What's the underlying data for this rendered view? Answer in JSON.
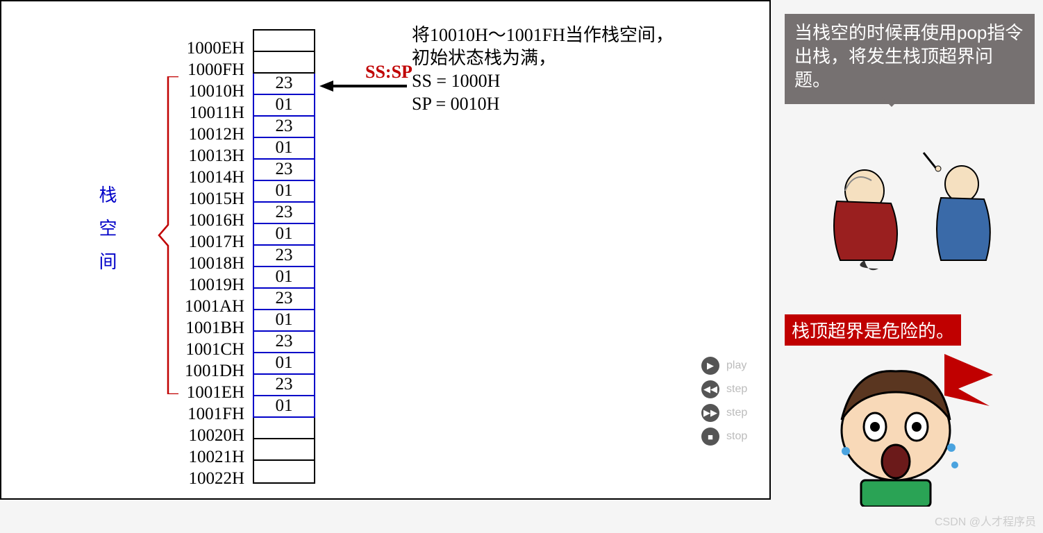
{
  "stack_label": "栈空间",
  "ss_sp_label": "SS:SP",
  "description": {
    "line1": "将10010H～1001FH当作栈空间，",
    "line2": "初始状态栈为满，",
    "line3": "SS = 1000H",
    "line4": "SP = 0010H"
  },
  "addresses": [
    "1000EH",
    "1000FH",
    "10010H",
    "10011H",
    "10012H",
    "10013H",
    "10014H",
    "10015H",
    "10016H",
    "10017H",
    "10018H",
    "10019H",
    "1001AH",
    "1001BH",
    "1001CH",
    "1001DH",
    "1001EH",
    "1001FH",
    "10020H",
    "10021H",
    "10022H"
  ],
  "values": [
    "",
    "",
    "23",
    "01",
    "23",
    "01",
    "23",
    "01",
    "23",
    "01",
    "23",
    "01",
    "23",
    "01",
    "23",
    "01",
    "23",
    "01",
    "",
    "",
    ""
  ],
  "stack_start_index": 2,
  "stack_end_index": 17,
  "bubble_text": "当栈空的时候再使用pop指令出栈，将发生栈顶超界问题。",
  "redbox_text": "栈顶超界是危险的。",
  "controls": {
    "play": "play",
    "step_back": "step",
    "step_fwd": "step",
    "stop": "stop"
  },
  "watermark": "CSDN @人才程序员"
}
